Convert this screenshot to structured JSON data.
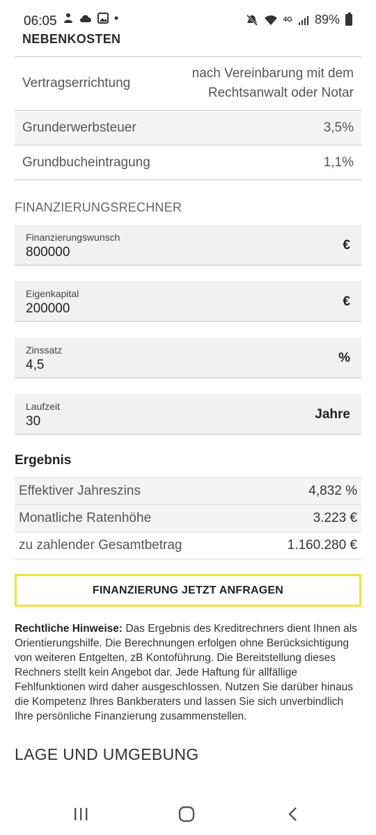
{
  "status": {
    "time": "06:05",
    "battery": "89%",
    "network": "4G"
  },
  "section_header": "NEBENKOSTEN",
  "costs": [
    {
      "label": "Vertragserrichtung",
      "value_line1": "nach Vereinbarung mit dem",
      "value_line2": "Rechtsanwalt oder Notar"
    },
    {
      "label": "Grunderwerbsteuer",
      "value": "3,5%"
    },
    {
      "label": "Grundbucheintragung",
      "value": "1,1%"
    }
  ],
  "calculator": {
    "title": "FINANZIERUNGSRECHNER",
    "fields": [
      {
        "label": "Finanzierungswunsch",
        "value": "800000",
        "unit": "€"
      },
      {
        "label": "Eigenkapital",
        "value": "200000",
        "unit": "€"
      },
      {
        "label": "Zinssatz",
        "value": "4,5",
        "unit": "%"
      },
      {
        "label": "Laufzeit",
        "value": "30",
        "unit": "Jahre"
      }
    ]
  },
  "result": {
    "title": "Ergebnis",
    "rows": [
      {
        "label": "Effektiver Jahreszins",
        "value": "4,832 %"
      },
      {
        "label": "Monatliche Ratenhöhe",
        "value": "3.223 €"
      },
      {
        "label": "zu zahlender Gesamtbetrag",
        "value": "1.160.280 €"
      }
    ]
  },
  "cta_label": "FINANZIERUNG JETZT ANFRAGEN",
  "legal": {
    "heading": "Rechtliche Hinweise:",
    "text": " Das Ergebnis des Kreditrechners dient Ihnen als Orientierungshilfe. Die Berechnungen erfolgen ohne Berücksichtigung von weiteren Entgelten, zB Kontoführung. Die Bereitstellung dieses Rechners stellt kein Angebot dar. Jede Haftung für allfällige Fehlfunktionen wird daher ausgeschlossen. Nutzen Sie darüber hinaus die Kompetenz Ihres Bankberaters und lassen Sie sich unverbindlich Ihre persönliche Finanzierung zusammenstellen."
  },
  "lage_title": "LAGE UND UMGEBUNG",
  "icons": {
    "status_left": [
      "person-icon",
      "cloud-icon",
      "image-icon",
      "dot-icon"
    ],
    "status_right": [
      "mute-icon",
      "wifi-icon",
      "signal-icon",
      "battery-icon"
    ],
    "nav": [
      "recents-icon",
      "home-icon",
      "back-icon"
    ]
  },
  "colors": {
    "accent_border": "#f2e33a"
  }
}
